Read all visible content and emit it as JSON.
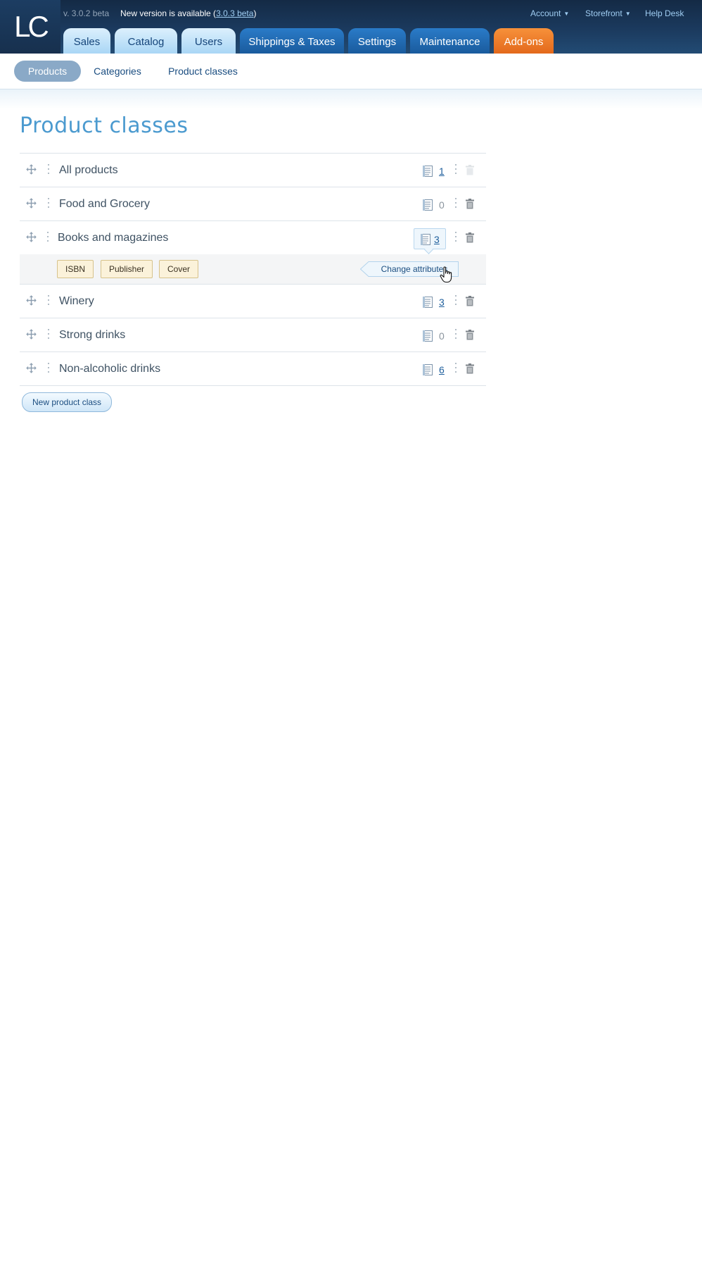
{
  "header": {
    "logo_text": "LC",
    "version": "v. 3.0.2 beta",
    "update_text": "New version is available (",
    "update_link": "3.0.3 beta",
    "update_suffix": ")",
    "account_label": "Account",
    "storefront_label": "Storefront",
    "helpdesk_label": "Help Desk",
    "tabs": [
      {
        "label": "Sales"
      },
      {
        "label": "Catalog"
      },
      {
        "label": "Users"
      },
      {
        "label": "Shippings & Taxes"
      },
      {
        "label": "Settings"
      },
      {
        "label": "Maintenance"
      },
      {
        "label": "Add-ons"
      }
    ]
  },
  "subnav": {
    "items": [
      {
        "label": "Products",
        "active": true
      },
      {
        "label": "Categories"
      },
      {
        "label": "Product classes"
      }
    ]
  },
  "page": {
    "title": "Product classes",
    "new_button_label": "New product class"
  },
  "classes": [
    {
      "name": "All products",
      "attr_count": "1"
    },
    {
      "name": "Food and Grocery",
      "attr_count": "0"
    },
    {
      "name": "Books and magazines",
      "attr_count": "3"
    },
    {
      "name": "Winery",
      "attr_count": "3"
    },
    {
      "name": "Strong drinks",
      "attr_count": "0"
    },
    {
      "name": "Non-alcoholic drinks",
      "attr_count": "6"
    }
  ],
  "expanded": {
    "attributes": [
      "ISBN",
      "Publisher",
      "Cover"
    ],
    "change_label": "Change attributes"
  },
  "colors": {
    "header_bg": "#1b3a5e",
    "accent": "#4b9acf",
    "orange_tab": "#e3691c",
    "link": "#1f5f9c"
  },
  "icons": [
    "move-icon",
    "dots-vertical-icon",
    "document-list-icon",
    "trash-icon",
    "hand-cursor-icon",
    "caret-down-icon"
  ]
}
